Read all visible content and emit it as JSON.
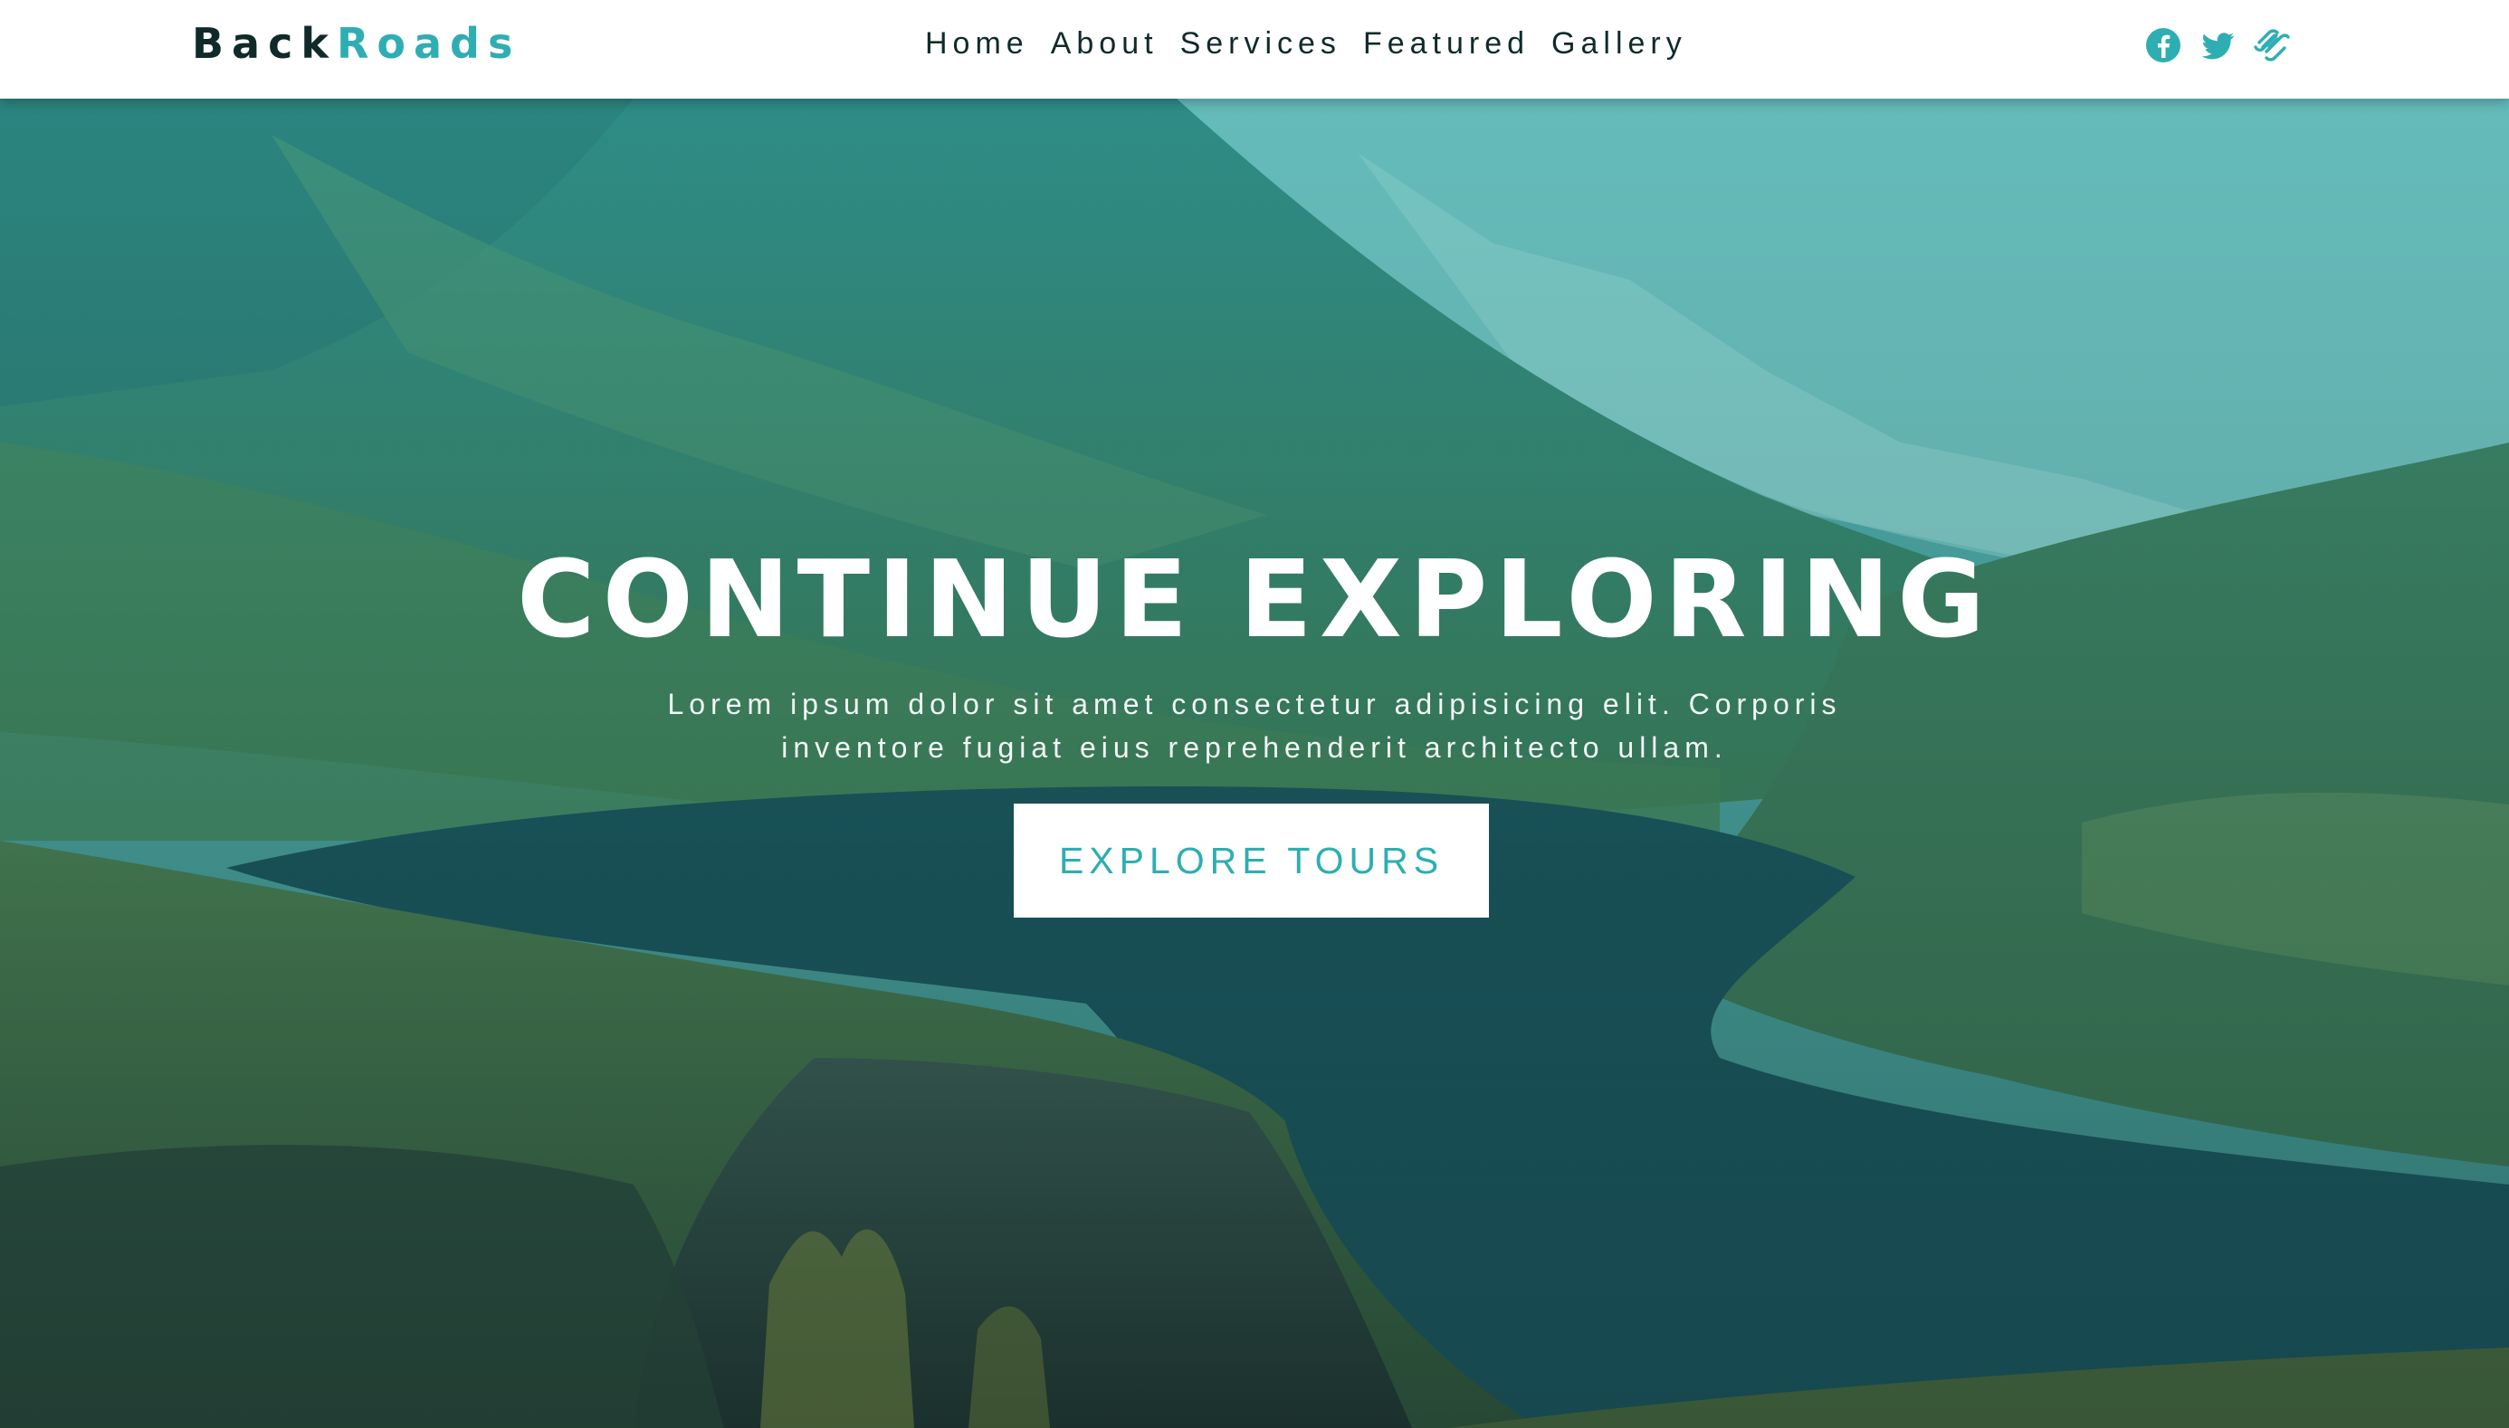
{
  "brand": {
    "part1": "Back",
    "part2": "Roads",
    "accent_color": "#2eaeb3",
    "dark_color": "#102a2a"
  },
  "nav": {
    "links": [
      {
        "label": "Home"
      },
      {
        "label": "About"
      },
      {
        "label": "Services"
      },
      {
        "label": "Featured"
      },
      {
        "label": "Gallery"
      }
    ]
  },
  "socials": [
    {
      "icon": "facebook-icon"
    },
    {
      "icon": "twitter-icon"
    },
    {
      "icon": "squarespace-icon"
    }
  ],
  "hero": {
    "title": "CONTINUE EXPLORING",
    "text": "Lorem ipsum dolor sit amet consectetur adipisicing elit. Corporis inventore fugiat eius reprehenderit architecto ullam.",
    "button_label": "EXPLORE TOURS",
    "background": "mountain-lake-photo"
  }
}
